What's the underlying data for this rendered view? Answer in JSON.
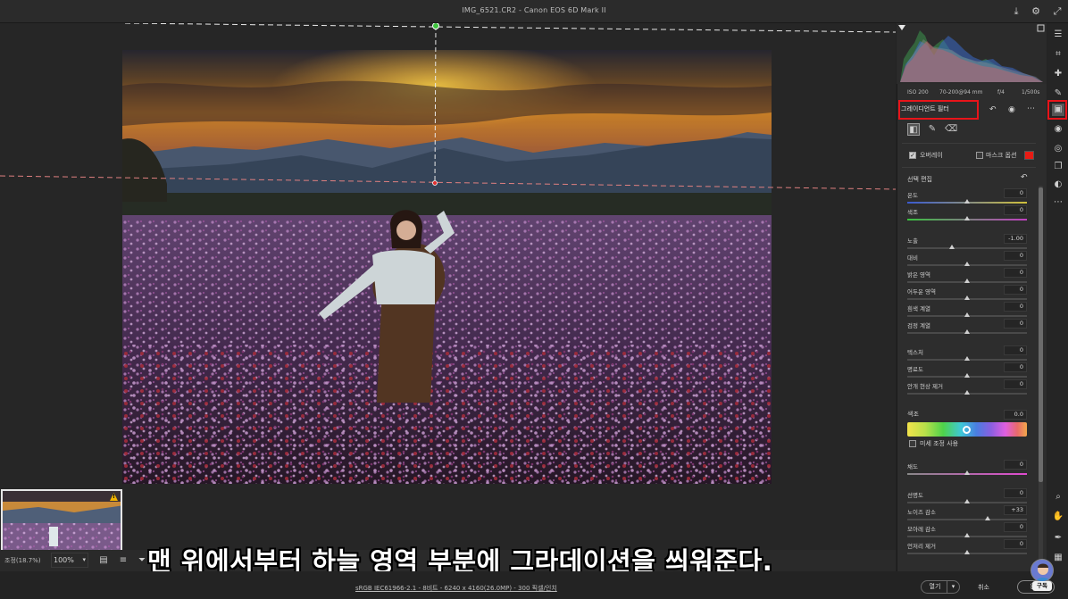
{
  "window": {
    "title": "IMG_6521.CR2  -  Canon EOS 6D Mark II"
  },
  "camera_info": {
    "iso": "ISO 200",
    "lens": "70-200@94 mm",
    "aperture": "f/4",
    "shutter": "1/500s"
  },
  "tool_panel": {
    "title": "그레이디언트 필터",
    "overlay_label": "오버레이",
    "overlay_checked": true,
    "mask_options_label": "마스크 옵션",
    "mask_color": "#e81b14",
    "section_title": "선택 편집",
    "sliders_group1": [
      {
        "name": "온도",
        "value": "0",
        "pos": 0.5
      },
      {
        "name": "색조",
        "value": "0",
        "pos": 0.5
      }
    ],
    "sliders_group2": [
      {
        "name": "노출",
        "value": "-1.00",
        "pos": 0.37
      },
      {
        "name": "대비",
        "value": "0",
        "pos": 0.5
      },
      {
        "name": "밝은 영역",
        "value": "0",
        "pos": 0.5
      },
      {
        "name": "어두운 영역",
        "value": "0",
        "pos": 0.5
      },
      {
        "name": "흰색 계열",
        "value": "0",
        "pos": 0.5
      },
      {
        "name": "검정 계열",
        "value": "0",
        "pos": 0.5
      }
    ],
    "sliders_group3": [
      {
        "name": "텍스처",
        "value": "0",
        "pos": 0.5
      },
      {
        "name": "명료도",
        "value": "0",
        "pos": 0.5
      },
      {
        "name": "안개 현상 제거",
        "value": "0",
        "pos": 0.5
      }
    ],
    "hue_label": "색조",
    "hue_value": "0.0",
    "fine_adjust_label": "미세 조정 사용",
    "saturation": {
      "name": "채도",
      "value": "0",
      "pos": 0.5
    },
    "sliders_group4": [
      {
        "name": "선명도",
        "value": "0",
        "pos": 0.5
      },
      {
        "name": "노이즈 감소",
        "value": "+33",
        "pos": 0.67
      },
      {
        "name": "모아레 감소",
        "value": "0",
        "pos": 0.5
      },
      {
        "name": "언저리 제거",
        "value": "0",
        "pos": 0.5
      }
    ]
  },
  "bottombar": {
    "zoom_label": "조정(18.7%)",
    "zoom_value": "100%"
  },
  "footer": {
    "info": "sRGB IEC61966-2.1 - 8비트 - 6240 x 4160(26.0MP) - 300 픽셀/인치",
    "open_button": "열기",
    "cancel_button": "취소",
    "done_button": "완료"
  },
  "subtitle": "맨 위에서부터 하늘 영역 부분에 그라데이션을 씌워준다.",
  "avatar_badge": "구독",
  "colors": {
    "highlight": "#e8141a",
    "panel": "#2d2d2d",
    "accent_pin": "#3ec43e"
  }
}
